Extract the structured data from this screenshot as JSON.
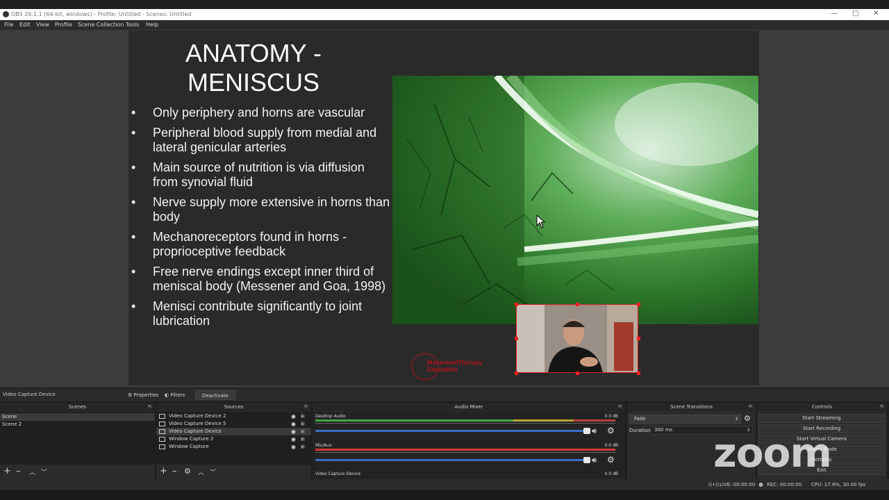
{
  "window": {
    "title": "OBS 26.1.1 (64-bit, windows) - Profile: Untitled - Scenes: Untitled",
    "controls": [
      "—",
      "□",
      "✕"
    ]
  },
  "menu": [
    "File",
    "Edit",
    "View",
    "Profile",
    "Scene Collection",
    "Tools",
    "Help"
  ],
  "slide": {
    "title_line1": "ANATOMY -",
    "title_line2": "MENISCUS",
    "bullets": [
      "Only periphery and horns are vascular",
      "Peripheral blood supply from medial and lateral genicular arteries",
      "Main source of nutrition is via diffusion from synovial fluid",
      "Nerve supply more extensive in horns than body",
      "Mechanoreceptors found in horns - proprioceptive feedback",
      "Free nerve endings except inner third of meniscal body (Messener and Goa, 1998)",
      "Menisci contribute significantly to joint lubrication"
    ],
    "bullet_glyph": "•",
    "logo_line1": "MovementTherapy",
    "logo_line2": "Education"
  },
  "source_toolbar": {
    "selected_source": "Video Capture Device",
    "properties": "Properties",
    "filters": "Filters",
    "deactivate": "Deactivate"
  },
  "scenes": {
    "title": "Scenes",
    "items": [
      "Scene",
      "Scene 2"
    ]
  },
  "sources": {
    "title": "Sources",
    "items": [
      "Video Capture Device 2",
      "Video Capture Device 5",
      "Video Capture Device",
      "Window Capture 2",
      "Window Capture"
    ]
  },
  "audio_mixer": {
    "title": "Audio Mixer",
    "channels": [
      {
        "name": "Desktop Audio",
        "db": "0.0 dB",
        "meter_color": "#3faa3f"
      },
      {
        "name": "Mic/Aux",
        "db": "0.0 dB",
        "meter_color": "#d83a3a"
      },
      {
        "name": "Video Capture Device",
        "db": "0.0 dB"
      }
    ]
  },
  "transitions": {
    "title": "Scene Transitions",
    "selected": "Fade",
    "duration_label": "Duration",
    "duration_value": "300 ms"
  },
  "controls": {
    "title": "Controls",
    "buttons": [
      "Start Streaming",
      "Start Recording",
      "Start Virtual Camera",
      "Studio Mode",
      "Settings",
      "Exit"
    ]
  },
  "status": {
    "live": "LIVE: 00:00:00",
    "rec": "REC: 00:00:00",
    "cpu": "CPU: 17.8%, 30.00 fps"
  },
  "watermark": "zoom",
  "dock_glyphs": {
    "undock": "⇱",
    "add": "+",
    "remove": "–",
    "gear": "⚙",
    "up": "︿",
    "down": "﹀"
  },
  "colors": {
    "accent_red": "#e02020",
    "slider_blue": "#3a6ec8",
    "panel_bg": "#2b2b2b"
  }
}
